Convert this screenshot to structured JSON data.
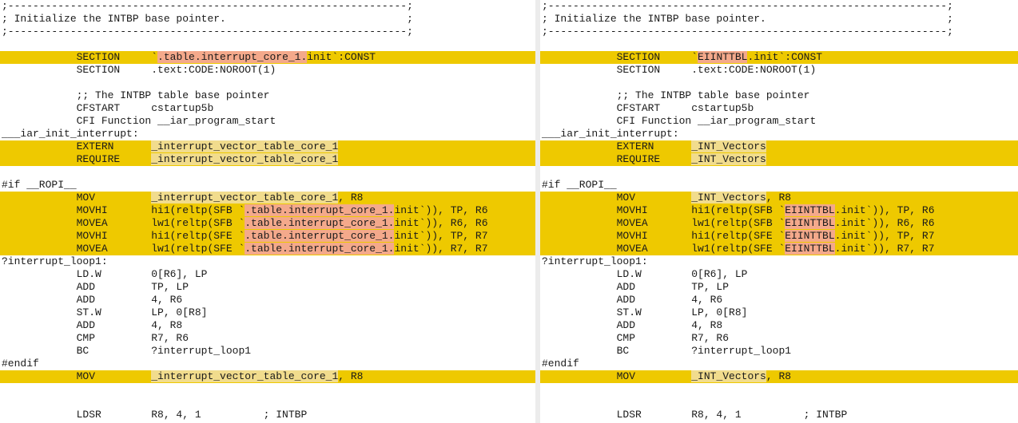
{
  "colors": {
    "changed_line": "#eec900",
    "inline_change": "#f4a98b",
    "divider": "#ececec"
  },
  "panes": [
    {
      "id": "left",
      "lines": [
        {
          "row": 0,
          "segs": [
            {
              "t": ";----------------------------------------------------------------;"
            }
          ]
        },
        {
          "row": 1,
          "segs": [
            {
              "t": "; Initialize the INTBP base pointer.                             ;"
            }
          ]
        },
        {
          "row": 2,
          "segs": [
            {
              "t": ";----------------------------------------------------------------;"
            }
          ]
        },
        {
          "row": 4,
          "changed": true,
          "segs": [
            {
              "t": "            SECTION     `"
            },
            {
              "t": ".table.interrupt_core_1.",
              "h": 1
            },
            {
              "t": "init`:CONST"
            }
          ]
        },
        {
          "row": 5,
          "segs": [
            {
              "t": "            SECTION     .text:CODE:NOROOT(1)"
            }
          ]
        },
        {
          "row": 7,
          "segs": [
            {
              "t": "            ;; The INTBP table base pointer"
            }
          ]
        },
        {
          "row": 8,
          "segs": [
            {
              "t": "            CFSTART     cstartup5b"
            }
          ]
        },
        {
          "row": 9,
          "segs": [
            {
              "t": "            CFI Function __iar_program_start"
            }
          ]
        },
        {
          "row": 10,
          "segs": [
            {
              "t": "___iar_init_interrupt:"
            }
          ]
        },
        {
          "row": 11,
          "changed": true,
          "segs": [
            {
              "t": "            EXTERN      "
            },
            {
              "t": "_interrupt_vector_table_core_1",
              "h": 2
            }
          ]
        },
        {
          "row": 12,
          "changed": true,
          "segs": [
            {
              "t": "            REQUIRE     "
            },
            {
              "t": "_interrupt_vector_table_core_1",
              "h": 2
            }
          ]
        },
        {
          "row": 14,
          "segs": [
            {
              "t": "#if __ROPI__"
            }
          ]
        },
        {
          "row": 15,
          "changed": true,
          "segs": [
            {
              "t": "            MOV         "
            },
            {
              "t": "_interrupt_vector_table_core_1",
              "h": 2
            },
            {
              "t": ", R8"
            }
          ]
        },
        {
          "row": 16,
          "changed": true,
          "segs": [
            {
              "t": "            MOVHI       hi1(reltp(SFB `"
            },
            {
              "t": ".table.interrupt_core_1.",
              "h": 1
            },
            {
              "t": "init`)), TP, R6"
            }
          ]
        },
        {
          "row": 17,
          "changed": true,
          "segs": [
            {
              "t": "            MOVEA       lw1(reltp(SFB `"
            },
            {
              "t": ".table.interrupt_core_1.",
              "h": 1
            },
            {
              "t": "init`)), R6, R6"
            }
          ]
        },
        {
          "row": 18,
          "changed": true,
          "segs": [
            {
              "t": "            MOVHI       hi1(reltp(SFE `"
            },
            {
              "t": ".table.interrupt_core_1.",
              "h": 1
            },
            {
              "t": "init`)), TP, R7"
            }
          ]
        },
        {
          "row": 19,
          "changed": true,
          "segs": [
            {
              "t": "            MOVEA       lw1(reltp(SFE `"
            },
            {
              "t": ".table.interrupt_core_1.",
              "h": 1
            },
            {
              "t": "init`)), R7, R7"
            }
          ]
        },
        {
          "row": 20,
          "segs": [
            {
              "t": "?interrupt_loop1:"
            }
          ]
        },
        {
          "row": 21,
          "segs": [
            {
              "t": "            LD.W        0[R6], LP"
            }
          ]
        },
        {
          "row": 22,
          "segs": [
            {
              "t": "            ADD         TP, LP"
            }
          ]
        },
        {
          "row": 23,
          "segs": [
            {
              "t": "            ADD         4, R6"
            }
          ]
        },
        {
          "row": 24,
          "segs": [
            {
              "t": "            ST.W        LP, 0[R8]"
            }
          ]
        },
        {
          "row": 25,
          "segs": [
            {
              "t": "            ADD         4, R8"
            }
          ]
        },
        {
          "row": 26,
          "segs": [
            {
              "t": "            CMP         R7, R6"
            }
          ]
        },
        {
          "row": 27,
          "segs": [
            {
              "t": "            BC          ?interrupt_loop1"
            }
          ]
        },
        {
          "row": 28,
          "segs": [
            {
              "t": "#endif"
            }
          ]
        },
        {
          "row": 29,
          "changed": true,
          "segs": [
            {
              "t": "            MOV         "
            },
            {
              "t": "_interrupt_vector_table_core_1",
              "h": 2
            },
            {
              "t": ", R8"
            }
          ]
        },
        {
          "row": 32,
          "segs": [
            {
              "t": "            LDSR        R8, 4, 1          ; INTBP"
            }
          ]
        }
      ]
    },
    {
      "id": "right",
      "lines": [
        {
          "row": 0,
          "segs": [
            {
              "t": ";----------------------------------------------------------------;"
            }
          ]
        },
        {
          "row": 1,
          "segs": [
            {
              "t": "; Initialize the INTBP base pointer.                             ;"
            }
          ]
        },
        {
          "row": 2,
          "segs": [
            {
              "t": ";----------------------------------------------------------------;"
            }
          ]
        },
        {
          "row": 4,
          "changed": true,
          "segs": [
            {
              "t": "            SECTION     `"
            },
            {
              "t": "EIINTTBL",
              "h": 1
            },
            {
              "t": ".init`:CONST"
            }
          ]
        },
        {
          "row": 5,
          "segs": [
            {
              "t": "            SECTION     .text:CODE:NOROOT(1)"
            }
          ]
        },
        {
          "row": 7,
          "segs": [
            {
              "t": "            ;; The INTBP table base pointer"
            }
          ]
        },
        {
          "row": 8,
          "segs": [
            {
              "t": "            CFSTART     cstartup5b"
            }
          ]
        },
        {
          "row": 9,
          "segs": [
            {
              "t": "            CFI Function __iar_program_start"
            }
          ]
        },
        {
          "row": 10,
          "segs": [
            {
              "t": "___iar_init_interrupt:"
            }
          ]
        },
        {
          "row": 11,
          "changed": true,
          "segs": [
            {
              "t": "            EXTERN      "
            },
            {
              "t": "_INT_Vectors",
              "h": 2
            }
          ]
        },
        {
          "row": 12,
          "changed": true,
          "segs": [
            {
              "t": "            REQUIRE     "
            },
            {
              "t": "_INT_Vectors",
              "h": 2
            }
          ]
        },
        {
          "row": 14,
          "segs": [
            {
              "t": "#if __ROPI__"
            }
          ]
        },
        {
          "row": 15,
          "changed": true,
          "segs": [
            {
              "t": "            MOV         "
            },
            {
              "t": "_INT_Vectors",
              "h": 2
            },
            {
              "t": ", R8"
            }
          ]
        },
        {
          "row": 16,
          "changed": true,
          "segs": [
            {
              "t": "            MOVHI       hi1(reltp(SFB `"
            },
            {
              "t": "EIINTTBL",
              "h": 1
            },
            {
              "t": ".init`)), TP, R6"
            }
          ]
        },
        {
          "row": 17,
          "changed": true,
          "segs": [
            {
              "t": "            MOVEA       lw1(reltp(SFB `"
            },
            {
              "t": "EIINTTBL",
              "h": 1
            },
            {
              "t": ".init`)), R6, R6"
            }
          ]
        },
        {
          "row": 18,
          "changed": true,
          "segs": [
            {
              "t": "            MOVHI       hi1(reltp(SFE `"
            },
            {
              "t": "EIINTTBL",
              "h": 1
            },
            {
              "t": ".init`)), TP, R7"
            }
          ]
        },
        {
          "row": 19,
          "changed": true,
          "segs": [
            {
              "t": "            MOVEA       lw1(reltp(SFE `"
            },
            {
              "t": "EIINTTBL",
              "h": 1
            },
            {
              "t": ".init`)), R7, R7"
            }
          ]
        },
        {
          "row": 20,
          "segs": [
            {
              "t": "?interrupt_loop1:"
            }
          ]
        },
        {
          "row": 21,
          "segs": [
            {
              "t": "            LD.W        0[R6], LP"
            }
          ]
        },
        {
          "row": 22,
          "segs": [
            {
              "t": "            ADD         TP, LP"
            }
          ]
        },
        {
          "row": 23,
          "segs": [
            {
              "t": "            ADD         4, R6"
            }
          ]
        },
        {
          "row": 24,
          "segs": [
            {
              "t": "            ST.W        LP, 0[R8]"
            }
          ]
        },
        {
          "row": 25,
          "segs": [
            {
              "t": "            ADD         4, R8"
            }
          ]
        },
        {
          "row": 26,
          "segs": [
            {
              "t": "            CMP         R7, R6"
            }
          ]
        },
        {
          "row": 27,
          "segs": [
            {
              "t": "            BC          ?interrupt_loop1"
            }
          ]
        },
        {
          "row": 28,
          "segs": [
            {
              "t": "#endif"
            }
          ]
        },
        {
          "row": 29,
          "changed": true,
          "segs": [
            {
              "t": "            MOV         "
            },
            {
              "t": "_INT_Vectors",
              "h": 2
            },
            {
              "t": ", R8"
            }
          ]
        },
        {
          "row": 32,
          "segs": [
            {
              "t": "            LDSR        R8, 4, 1          ; INTBP"
            }
          ]
        }
      ]
    }
  ]
}
